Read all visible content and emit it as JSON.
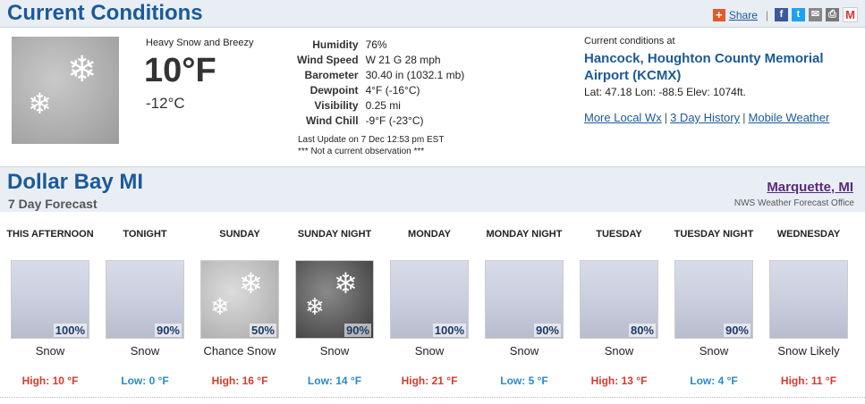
{
  "current": {
    "title": "Current Conditions",
    "share_label": "Share",
    "description": "Heavy Snow and Breezy",
    "temp_f": "10°F",
    "temp_c": "-12°C",
    "details": [
      {
        "k": "Humidity",
        "v": "76%"
      },
      {
        "k": "Wind Speed",
        "v": "W 21 G 28 mph"
      },
      {
        "k": "Barometer",
        "v": "30.40 in (1032.1 mb)"
      },
      {
        "k": "Dewpoint",
        "v": "4°F (-16°C)"
      },
      {
        "k": "Visibility",
        "v": "0.25 mi"
      },
      {
        "k": "Wind Chill",
        "v": "-9°F (-23°C)"
      }
    ],
    "last_update": "Last Update on 7 Dec 12:53 pm EST",
    "not_current": "*** Not a current observation ***",
    "location_label": "Current conditions at",
    "location_name": "Hancock, Houghton County Memorial Airport (KCMX)",
    "latlon": "Lat: 47.18 Lon: -88.5 Elev: 1074ft.",
    "links": [
      "More Local Wx",
      "3 Day History",
      "Mobile Weather"
    ]
  },
  "forecast": {
    "city": "Dollar Bay MI",
    "subtitle": "7 Day Forecast",
    "office": "Marquette, MI",
    "office_label": "NWS Weather Forecast Office",
    "days": [
      {
        "name": "THIS AFTERNOON",
        "pct": "100%",
        "desc": "Snow",
        "temp": "High: 10 °F",
        "type": "hi",
        "icon": "snow"
      },
      {
        "name": "TONIGHT",
        "pct": "90%",
        "desc": "Snow",
        "temp": "Low: 0 °F",
        "type": "lo",
        "icon": "snow"
      },
      {
        "name": "SUNDAY",
        "pct": "50%",
        "desc": "Chance Snow",
        "temp": "High: 16 °F",
        "type": "hi",
        "icon": "chance"
      },
      {
        "name": "SUNDAY NIGHT",
        "pct": "90%",
        "desc": "Snow",
        "temp": "Low: 14 °F",
        "type": "lo",
        "icon": "night"
      },
      {
        "name": "MONDAY",
        "pct": "100%",
        "desc": "Snow",
        "temp": "High: 21 °F",
        "type": "hi",
        "icon": "snow"
      },
      {
        "name": "MONDAY NIGHT",
        "pct": "90%",
        "desc": "Snow",
        "temp": "Low: 5 °F",
        "type": "lo",
        "icon": "snow"
      },
      {
        "name": "TUESDAY",
        "pct": "80%",
        "desc": "Snow",
        "temp": "High: 13 °F",
        "type": "hi",
        "icon": "snow"
      },
      {
        "name": "TUESDAY NIGHT",
        "pct": "90%",
        "desc": "Snow",
        "temp": "Low: 4 °F",
        "type": "lo",
        "icon": "snow"
      },
      {
        "name": "WEDNESDAY",
        "pct": "",
        "desc": "Snow Likely",
        "temp": "High: 11 °F",
        "type": "hi",
        "icon": "snow"
      }
    ]
  }
}
